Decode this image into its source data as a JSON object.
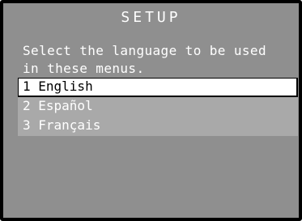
{
  "header": {
    "title": "SETUP"
  },
  "instructions": {
    "line1": "Select the language to be used",
    "line2": "in these menus."
  },
  "menu": {
    "items": [
      {
        "label": "1 English",
        "selected": true
      },
      {
        "label": "2 Español",
        "selected": false
      },
      {
        "label": "3 Français",
        "selected": false
      }
    ]
  },
  "colors": {
    "background": "#8f8f8f",
    "menu_background": "#a9a9a9",
    "selected_background": "#ffffff",
    "text": "#ffffff",
    "selected_text": "#000000",
    "frame": "#000000"
  }
}
